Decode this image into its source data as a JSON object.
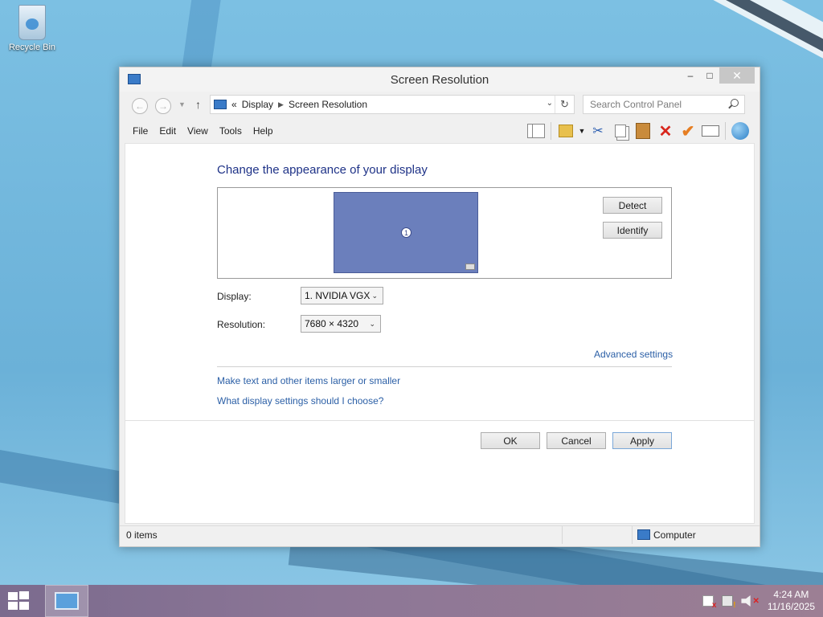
{
  "desktop": {
    "icons": [
      {
        "label": "Recycle Bin",
        "icon": "recycle-bin-icon"
      }
    ]
  },
  "window": {
    "title": "Screen Resolution",
    "controls": {
      "minimize": "–",
      "maximize": "□",
      "close": "✕"
    },
    "address": {
      "prefix": "«",
      "crumbs": [
        "Display",
        "Screen Resolution"
      ],
      "search_placeholder": "Search Control Panel"
    },
    "menu": [
      "File",
      "Edit",
      "View",
      "Tools",
      "Help"
    ],
    "toolbar_icons": [
      "layout-icon",
      "folder-icon",
      "cut-icon",
      "copy-icon",
      "paste-icon",
      "delete-icon",
      "check-icon",
      "properties-icon",
      "globe-icon"
    ],
    "content": {
      "heading": "Change the appearance of your display",
      "monitor_number": "1",
      "detect_label": "Detect",
      "identify_label": "Identify",
      "display_label": "Display:",
      "display_value": "1. NVIDIA VGX",
      "resolution_label": "Resolution:",
      "resolution_value": "7680 × 4320",
      "advanced_link": "Advanced settings",
      "larger_link": "Make text and other items larger or smaller",
      "which_link": "What display settings should I choose?",
      "ok_label": "OK",
      "cancel_label": "Cancel",
      "apply_label": "Apply"
    },
    "status": {
      "items": "0 items",
      "location": "Computer"
    }
  },
  "taskbar": {
    "time": "4:24 AM",
    "date": "11/16/2025"
  },
  "colors": {
    "heading": "#1e3287",
    "link": "#2b5fa6",
    "monitor": "#6b7fbc",
    "taskbar": "#8c7696"
  }
}
